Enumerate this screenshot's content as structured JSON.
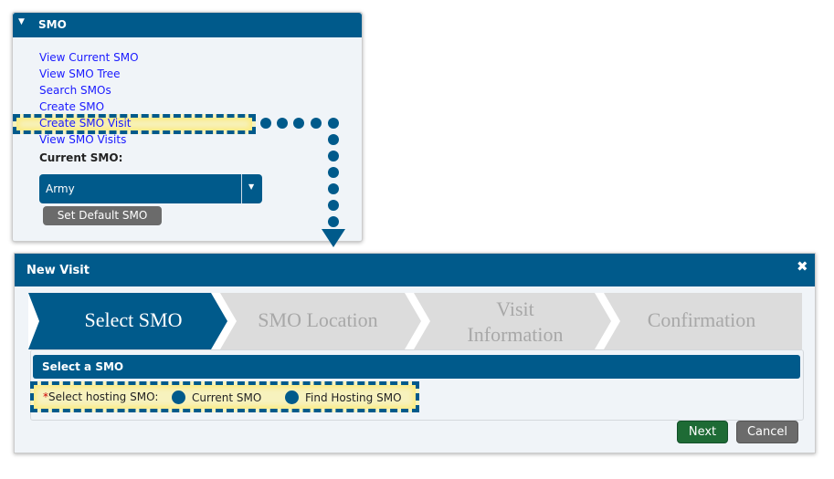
{
  "smo_panel": {
    "title": "SMO",
    "links": [
      "View Current SMO",
      "View SMO Tree",
      "Search SMOs",
      "Create SMO",
      "Create SMO Visit",
      "View SMO Visits"
    ],
    "current_label": "Current SMO:",
    "current_value": "Army",
    "set_default_label": "Set Default SMO"
  },
  "dialog": {
    "title": "New Visit",
    "close_icon": "close-icon",
    "steps": [
      {
        "label": "Select SMO",
        "active": true
      },
      {
        "label": "SMO Location",
        "active": false
      },
      {
        "label_line1": "Visit",
        "label_line2": "Information",
        "active": false
      },
      {
        "label": "Confirmation",
        "active": false
      }
    ],
    "section_title": "Select a SMO",
    "required_mark": "*",
    "field_label": "Select hosting SMO:",
    "options": [
      "Current SMO",
      "Find Hosting SMO"
    ],
    "next_label": "Next",
    "cancel_label": "Cancel"
  },
  "colors": {
    "primary": "#005a8b",
    "next": "#1e6b35",
    "cancel": "#6b6b6b",
    "highlight": "#fff07a",
    "link": "#1a1aff"
  }
}
